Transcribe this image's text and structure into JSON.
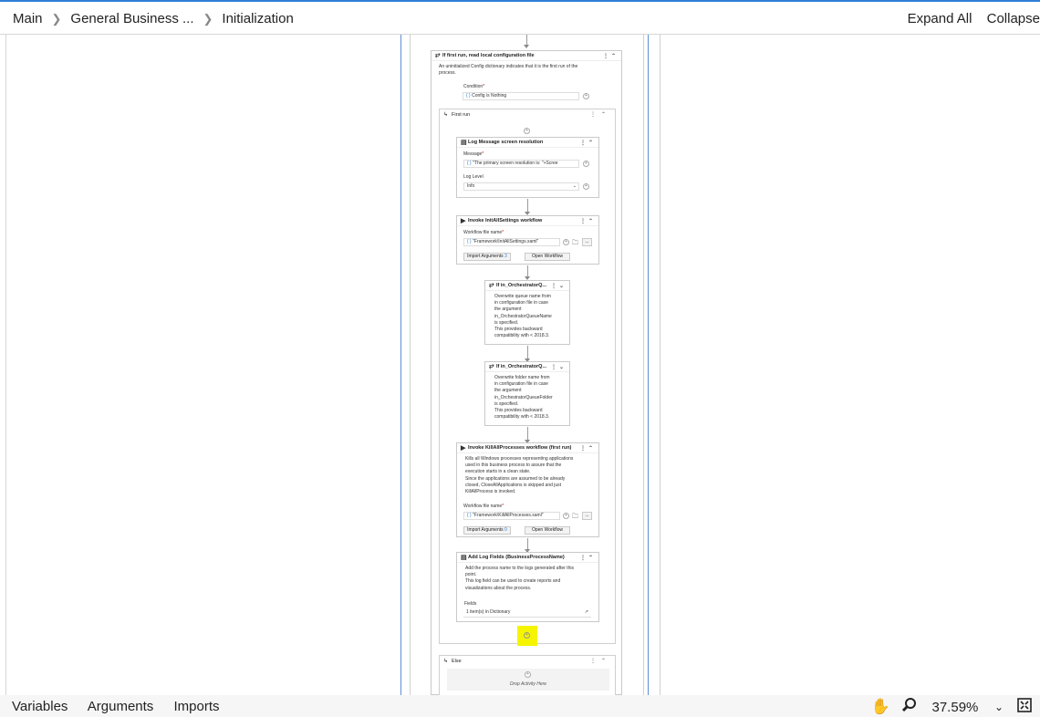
{
  "breadcrumb": {
    "items": [
      "Main",
      "General Business ...",
      "Initialization"
    ]
  },
  "toolbar": {
    "expand_all": "Expand All",
    "collapse_all": "Collapse"
  },
  "bottom": {
    "tabs": [
      "Variables",
      "Arguments",
      "Imports"
    ],
    "zoom": "37.59%"
  },
  "if_first_run": {
    "title": "If first run, read local configuration file",
    "annotation": [
      "An uninitialized Config dictionary indicates that it is the first run of the",
      "process."
    ],
    "condition_label": "Condition",
    "condition_value": "Config is Nothing"
  },
  "then_seq": {
    "title": "First run"
  },
  "log_message": {
    "title": "Log Message screen resolution",
    "message_label": "Message",
    "message_value": "\"The primary screen resolution is: \"+Scree",
    "level_label": "Log Level",
    "level_value": "Info"
  },
  "invoke_init": {
    "title": "Invoke InitAllSettings workflow",
    "file_label": "Workflow file name",
    "file_value": "\"Framework\\InitAllSettings.xaml\"",
    "import_label": "Import Arguments",
    "import_count": "3",
    "open_label": "Open Workflow"
  },
  "if_queue": {
    "title": "If in_OrchestratorQ...",
    "annotation": [
      "Overwrite queue name from",
      "in configuration file in case",
      "the argument",
      "in_OrchestratorQueueName",
      "is specified.",
      "This provides backward",
      "compatibility with < 2018.3."
    ]
  },
  "if_folder": {
    "title": "If in_OrchestratorQ...",
    "annotation": [
      "Overwrite folder name from",
      "in configuration file in case",
      "the argument",
      "in_OrchestratorQueueFolder",
      "is specified.",
      "This provides backward",
      "compatibility with < 2018.3."
    ]
  },
  "invoke_kill": {
    "title": "Invoke KillAllProcesses workflow (first run)",
    "annotation": [
      "Kills all Windows processes representing applications",
      "used in this business process to assure that the",
      "execution starts in a clean state.",
      "Since the applications are assumed to be already",
      "closed, CloseAllApplications is skipped and just",
      "KillAllProcess is invoked."
    ],
    "file_label": "Workflow file name",
    "file_value": "\"Framework\\KillAllProcesses.xaml\"",
    "import_label": "Import Arguments",
    "import_count": "0",
    "open_label": "Open Workflow"
  },
  "add_log_fields": {
    "title": "Add Log Fields (BusinessProcessName)",
    "annotation": [
      "Add the process name to the logs generated after this",
      "point.",
      "This log field can be used to create reports and",
      "visualizations about the process."
    ],
    "fields_label": "Fields",
    "fields_value": "1 item(s) in Dictionary"
  },
  "else_seq": {
    "title": "Else",
    "drop_hint": "Drop Activity Here"
  },
  "colors": {
    "accent": "#2d7fd6",
    "highlight": "#f5f500"
  }
}
